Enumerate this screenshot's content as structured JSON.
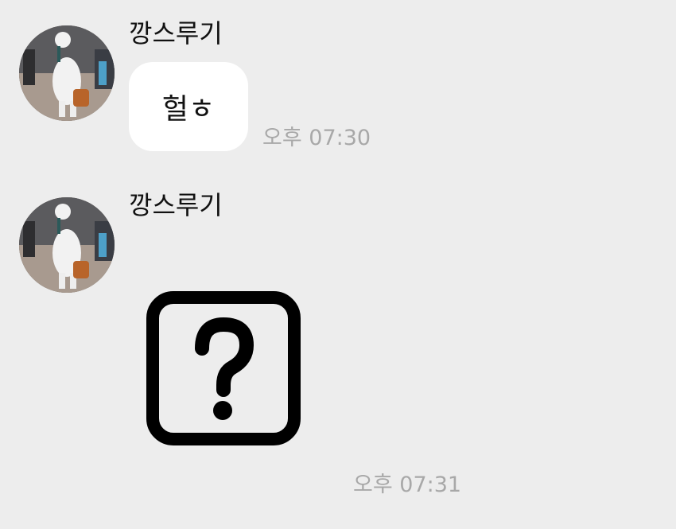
{
  "messages": [
    {
      "sender": "깡스루기",
      "text": "헐ㅎ",
      "time": "오후 07:30"
    },
    {
      "sender": "깡스루기",
      "emoticon": "question-mark-box-icon",
      "time": "오후 07:31"
    }
  ],
  "colors": {
    "background": "#ededed",
    "bubble": "#ffffff",
    "time_text": "#a8a8a8"
  }
}
